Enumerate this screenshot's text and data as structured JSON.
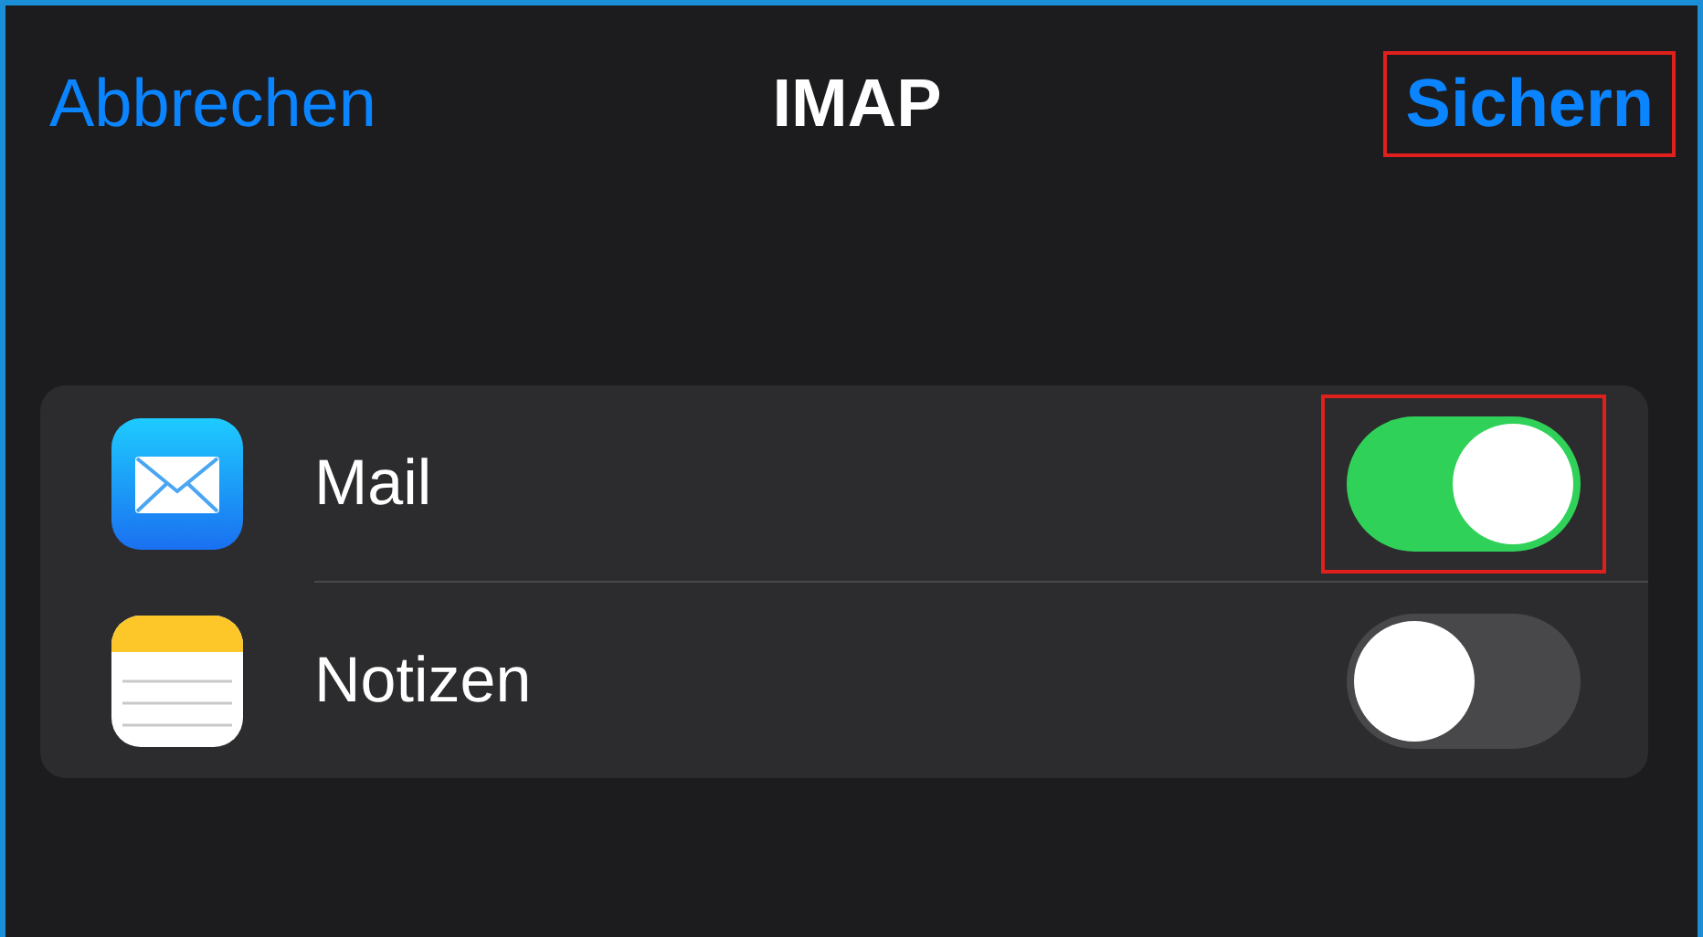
{
  "nav": {
    "cancel": "Abbrechen",
    "title": "IMAP",
    "save": {
      "label": "Sichern",
      "highlighted": true
    }
  },
  "rows": [
    {
      "kind": "mail",
      "label": "Mail",
      "on": true,
      "highlighted": true
    },
    {
      "kind": "notes",
      "label": "Notizen",
      "on": false,
      "highlighted": false
    }
  ]
}
